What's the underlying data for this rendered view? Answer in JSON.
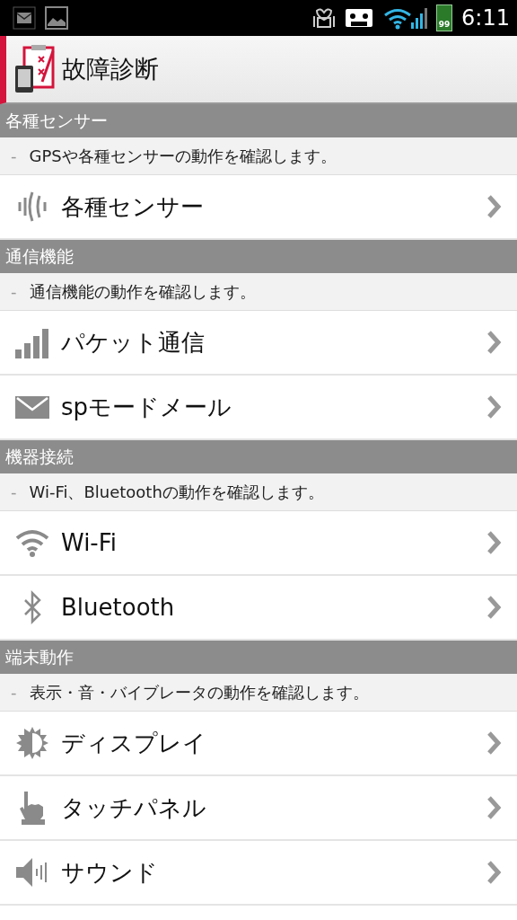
{
  "status_bar": {
    "notifications": [
      {
        "kind": "mail"
      },
      {
        "kind": "image"
      }
    ],
    "battery_text": "99",
    "time": "6:11"
  },
  "app_bar": {
    "title": "故障診断"
  },
  "sections": [
    {
      "title": "各種センサー",
      "bullet": "-",
      "description": "GPSや各種センサーの動作を確認します。",
      "items": [
        {
          "label": "各種センサー",
          "kind": "sensor"
        }
      ]
    },
    {
      "title": "通信機能",
      "bullet": "-",
      "description": "通信機能の動作を確認します。",
      "items": [
        {
          "label": "パケット通信",
          "kind": "signal"
        },
        {
          "label": "spモードメール",
          "kind": "mail"
        }
      ]
    },
    {
      "title": "機器接続",
      "bullet": "-",
      "description": "Wi-Fi、Bluetoothの動作を確認します。",
      "items": [
        {
          "label": "Wi-Fi",
          "kind": "wifi"
        },
        {
          "label": "Bluetooth",
          "kind": "bluetooth"
        }
      ]
    },
    {
      "title": "端末動作",
      "bullet": "-",
      "description": "表示・音・バイブレータの動作を確認します。",
      "items": [
        {
          "label": "ディスプレイ",
          "kind": "display"
        },
        {
          "label": "タッチパネル",
          "kind": "touch"
        },
        {
          "label": "サウンド",
          "kind": "sound"
        }
      ]
    }
  ]
}
